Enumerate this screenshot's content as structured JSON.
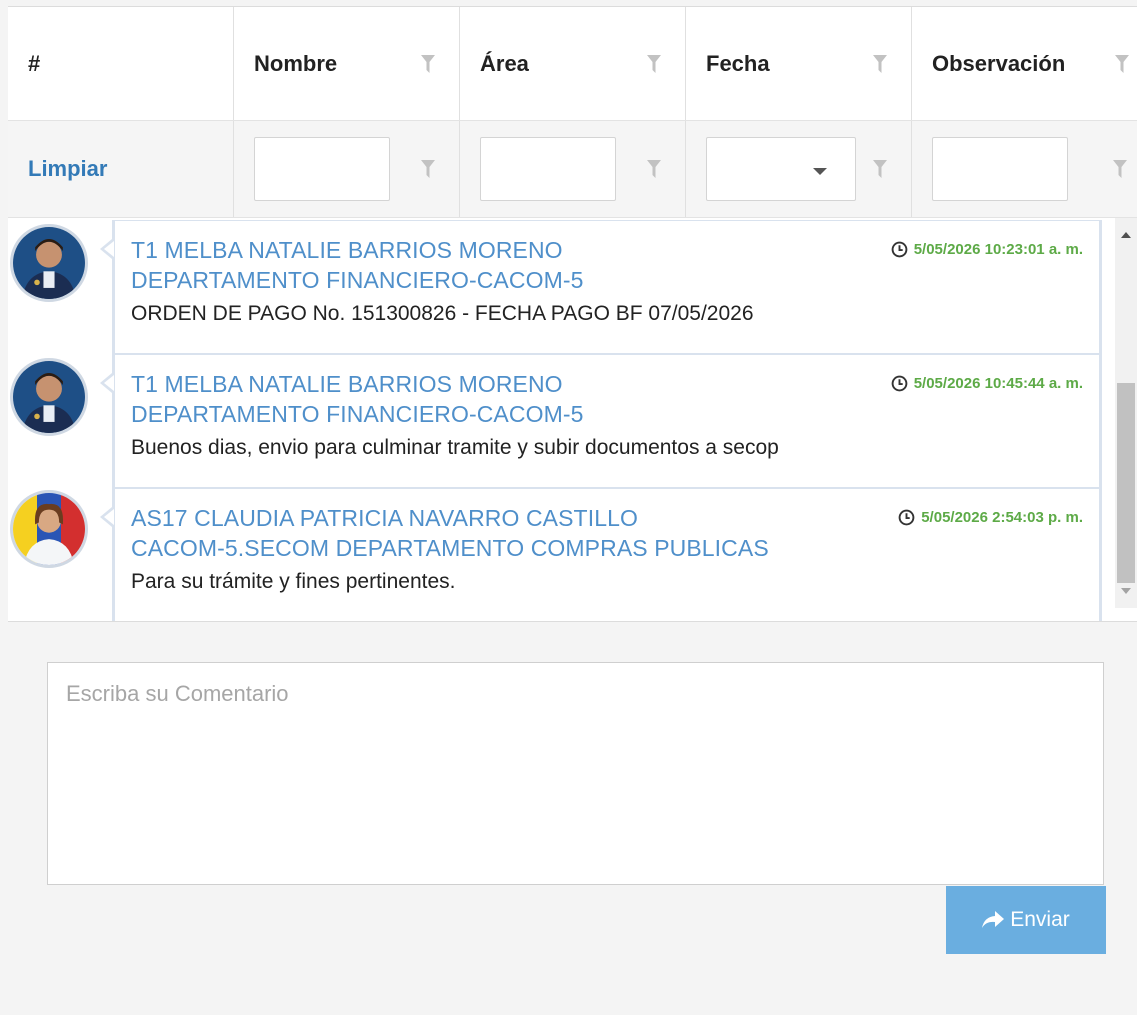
{
  "grid": {
    "columns": [
      {
        "label": "#"
      },
      {
        "label": "Nombre"
      },
      {
        "label": "Área"
      },
      {
        "label": "Fecha"
      },
      {
        "label": "Observación"
      }
    ],
    "clear_label": "Limpiar",
    "filters": {
      "nombre": "",
      "area": "",
      "fecha": "",
      "observacion": ""
    }
  },
  "messages": [
    {
      "author": "T1 MELBA NATALIE BARRIOS MORENO",
      "department": "DEPARTAMENTO FINANCIERO-CACOM-5",
      "text": "ORDEN DE PAGO No. 151300826 - FECHA PAGO BF 07/05/2026",
      "timestamp": "5/05/2026 10:23:01 a. m."
    },
    {
      "author": "T1 MELBA NATALIE BARRIOS MORENO",
      "department": "DEPARTAMENTO FINANCIERO-CACOM-5",
      "text": "Buenos dias, envio para culminar tramite y subir documentos a secop",
      "timestamp": "5/05/2026 10:45:44 a. m."
    },
    {
      "author": "AS17 CLAUDIA PATRICIA NAVARRO CASTILLO",
      "department": "CACOM-5.SECOM DEPARTAMENTO COMPRAS PUBLICAS",
      "text": "Para su trámite y fines pertinentes.",
      "timestamp": "5/05/2026 2:54:03 p. m."
    }
  ],
  "composer": {
    "placeholder": "Escriba su Comentario",
    "value": "",
    "send_label": "Enviar"
  },
  "colors": {
    "link": "#337ab7",
    "author": "#4f8fca",
    "timestamp": "#5daa47",
    "send_button": "#6aaee0"
  },
  "icons": {
    "filter": "funnel-icon",
    "clock": "clock-icon",
    "send": "share-arrow-icon",
    "dropdown": "caret-down-icon"
  }
}
